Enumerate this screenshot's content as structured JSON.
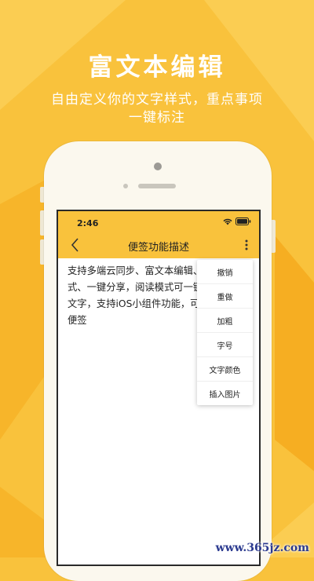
{
  "promo": {
    "headline": "富文本编辑",
    "subline_1": "自由定义你的文字样式，重点事项",
    "subline_2": "一键标注"
  },
  "status_bar": {
    "time": "2:46",
    "icons": [
      "wifi-icon",
      "battery-icon"
    ]
  },
  "nav": {
    "back_icon": "chevron-left-icon",
    "title": "便签功能描述",
    "more_icon": "more-vertical-icon"
  },
  "note": {
    "lines": [
      "支持多端云同步、富文本编辑、",
      "式、一键分享，阅读模式可一键",
      "文字，支持iOS小组件功能，可",
      "便签"
    ]
  },
  "menu": {
    "items": [
      "撤销",
      "重做",
      "加粗",
      "字号",
      "文字颜色",
      "插入图片"
    ]
  },
  "watermark": "www.365jz.com",
  "colors": {
    "brand_yellow": "#f9c23c",
    "phone_body": "#fbf8ee",
    "text": "#222222"
  }
}
